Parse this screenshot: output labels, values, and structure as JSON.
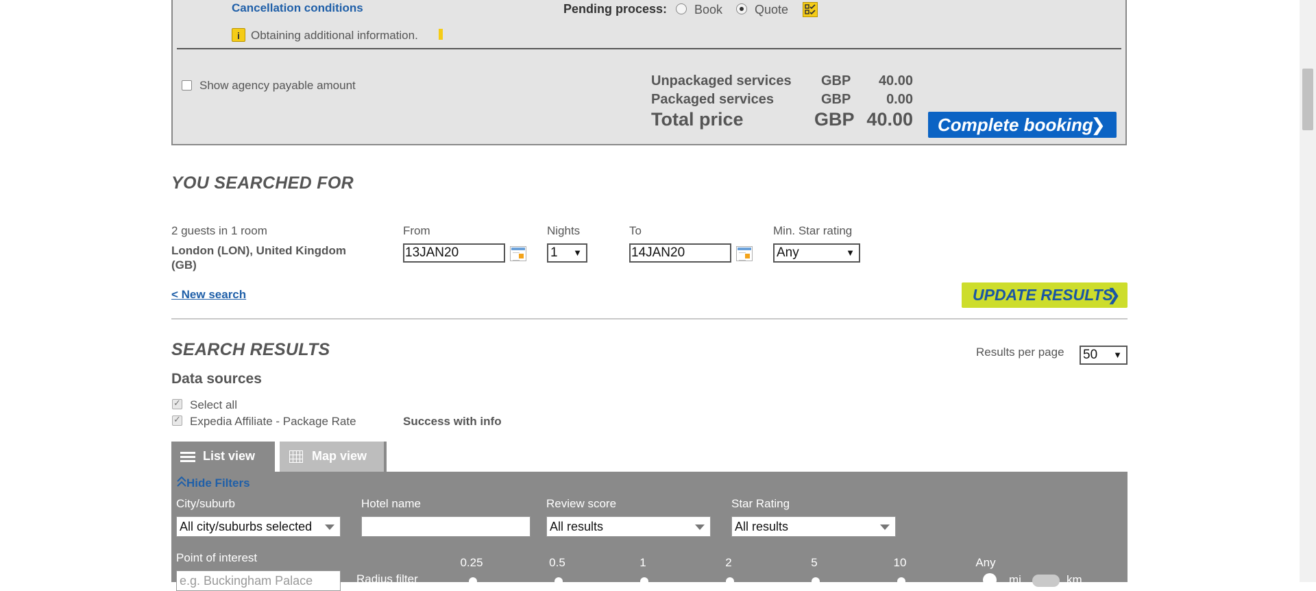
{
  "summary": {
    "cancellation_link": "Cancellation conditions",
    "pending_label": "Pending process:",
    "pending_options": [
      "Book",
      "Quote"
    ],
    "pending_selected": "Quote",
    "info_icon_text": "i",
    "info_text": "Obtaining additional information.",
    "agency_checkbox_label": "Show agency payable amount",
    "prices": [
      {
        "label": "Unpackaged services",
        "currency": "GBP",
        "amount": "40.00"
      },
      {
        "label": "Packaged services",
        "currency": "GBP",
        "amount": "0.00"
      }
    ],
    "total": {
      "label": "Total price",
      "currency": "GBP",
      "amount": "40.00"
    },
    "complete_button": "Complete booking",
    "complete_chevron": "❯"
  },
  "search": {
    "title": "YOU SEARCHED FOR",
    "guests": "2 guests in 1 room",
    "destination": "London (LON), United Kingdom (GB)",
    "from_label": "From",
    "from_value": "13JAN20",
    "nights_label": "Nights",
    "nights_value": "1",
    "to_label": "To",
    "to_value": "14JAN20",
    "star_label": "Min. Star rating",
    "star_value": "Any",
    "new_search_link": "< New search",
    "update_button": "UPDATE RESULTS",
    "update_chevron": "❯",
    "select_arrow": "▼"
  },
  "results": {
    "title": "SEARCH RESULTS",
    "per_page_label": "Results per page",
    "per_page_value": "50",
    "data_sources_title": "Data sources",
    "select_all": "Select all",
    "source_name": "Expedia Affiliate - Package Rate",
    "source_status": "Success with info",
    "tabs": [
      {
        "label": "List view",
        "icon": "list-icon"
      },
      {
        "label": "Map view",
        "icon": "grid-icon"
      }
    ]
  },
  "filters": {
    "hide_filters": "Hide Filters",
    "city_label": "City/suburb",
    "city_value": "All city/suburbs selected",
    "hotel_label": "Hotel name",
    "hotel_value": "",
    "review_label": "Review score",
    "review_value": "All results",
    "star_label": "Star Rating",
    "star_value": "All results",
    "poi_label": "Point of interest",
    "poi_placeholder": "e.g. Buckingham Palace",
    "radius_label": "Radius filter",
    "radius_ticks": [
      "0.25",
      "0.5",
      "1",
      "2",
      "5",
      "10",
      "Any"
    ],
    "unit_mi": "mi",
    "unit_km": "km"
  },
  "colors": {
    "primary_blue": "#0b63c4",
    "update_green": "#cddd2c",
    "info_yellow": "#f5cc17",
    "filter_gray": "#8a8a8a"
  }
}
